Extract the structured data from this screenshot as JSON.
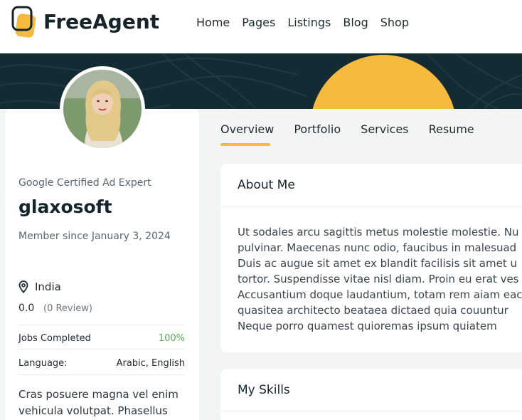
{
  "header": {
    "brand": "FreeAgent",
    "nav": [
      "Home",
      "Pages",
      "Listings",
      "Blog",
      "Shop"
    ]
  },
  "colors": {
    "accent": "#f6bb3c",
    "banner": "#152b33",
    "success": "#4caf50"
  },
  "profile": {
    "tagline": "Google Certified Ad Expert",
    "username": "glaxosoft",
    "member_since": "Member since January 3, 2024",
    "location": "India",
    "rating": "0.0",
    "reviews": "(0 Review)",
    "jobs_label": "Jobs Completed",
    "jobs_value": "100%",
    "language_label": "Language:",
    "language_value": "Arabic, English",
    "bio": "Cras posuere magna vel enim vehicula volutpat. Phasellus"
  },
  "tabs": [
    "Overview",
    "Portfolio",
    "Services",
    "Resume"
  ],
  "about": {
    "title": "About Me",
    "lines": [
      "Ut sodales arcu sagittis metus molestie molestie. Nu",
      "pulvinar. Maecenas nunc odio, faucibus in malesuad",
      "Duis ac augue sit amet ex blandit facilisis sit amet u",
      "tortor. Suspendisse vitae nisl diam. Proin eu erat ves",
      "Accusantium doque laudantium, totam rem aiam eac",
      "quasitea architecto beataea dictaed quia couuntur",
      "Neque porro quamest quioremas ipsum quiatem"
    ]
  },
  "skills": {
    "title": "My Skills"
  }
}
